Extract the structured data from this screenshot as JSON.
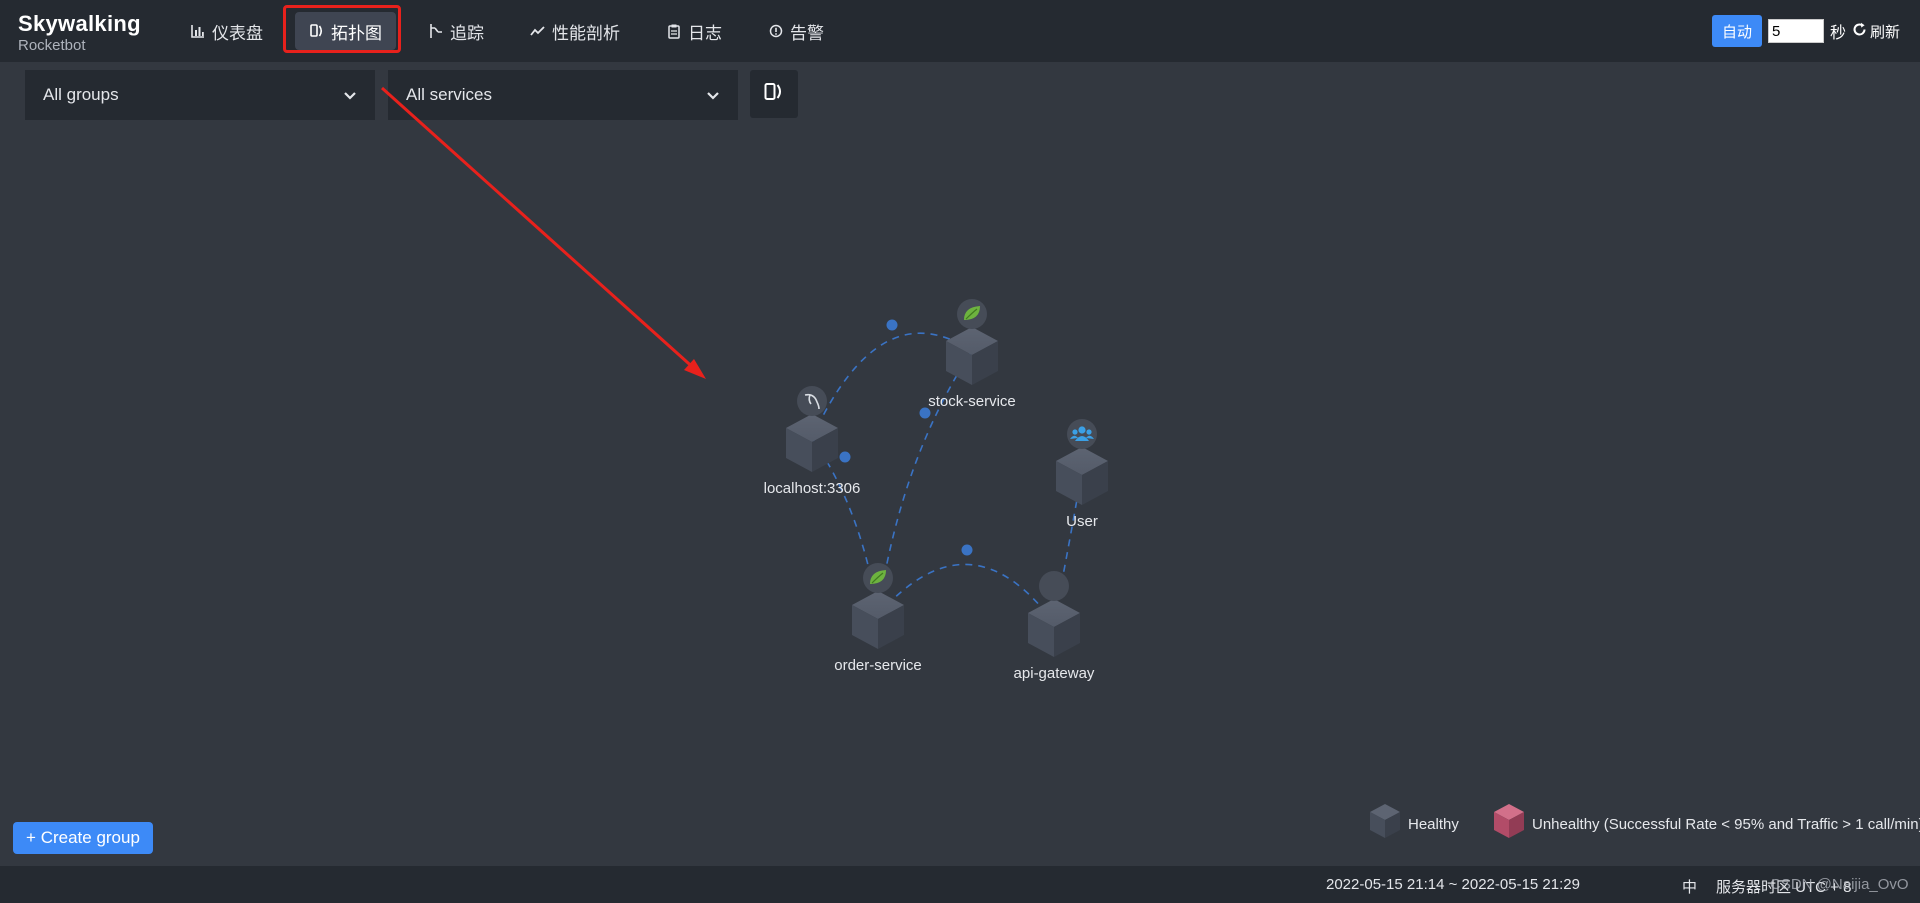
{
  "brand": {
    "name": "Skywalking",
    "subtitle": "Rocketbot"
  },
  "nav": [
    {
      "label": "仪表盘",
      "icon": "bar-chart-icon"
    },
    {
      "label": "拓扑图",
      "icon": "topology-icon",
      "active": true
    },
    {
      "label": "追踪",
      "icon": "trace-icon"
    },
    {
      "label": "性能剖析",
      "icon": "line-chart-icon"
    },
    {
      "label": "日志",
      "icon": "clipboard-icon"
    },
    {
      "label": "告警",
      "icon": "alarm-icon"
    }
  ],
  "controls": {
    "auto_label": "自动",
    "interval_value": "5",
    "sec_label": "秒",
    "refresh_label": "刷新"
  },
  "filters": {
    "group": "All groups",
    "service": "All services"
  },
  "topology": {
    "nodes": [
      {
        "id": "stock",
        "label": "stock-service",
        "icon": "spring-leaf-icon"
      },
      {
        "id": "db",
        "label": "localhost:3306",
        "icon": "mysql-dolphin-icon"
      },
      {
        "id": "user",
        "label": "User",
        "icon": "users-icon"
      },
      {
        "id": "order",
        "label": "order-service",
        "icon": "spring-leaf-icon"
      },
      {
        "id": "gateway",
        "label": "api-gateway",
        "icon": "gateway-icon"
      }
    ],
    "links": [
      {
        "from": "db",
        "to": "stock"
      },
      {
        "from": "order",
        "to": "db"
      },
      {
        "from": "order",
        "to": "stock"
      },
      {
        "from": "order",
        "to": "gateway"
      },
      {
        "from": "gateway",
        "to": "user"
      }
    ]
  },
  "create_group_label": "+ Create group",
  "legend": {
    "healthy": "Healthy",
    "unhealthy": "Unhealthy (Successful Rate < 95% and Traffic > 1 call/min)"
  },
  "footer": {
    "time_range": "2022-05-15 21:14 ~ 2022-05-15 21:29",
    "lang": "中",
    "timezone": "服务器时区 UTC + 8",
    "watermark": "CSDN @Naijia_OvO"
  },
  "colors": {
    "accent": "#3d8af7",
    "highlight": "#e8211c",
    "healthy": "#4b5260",
    "unhealthy": "#c0526f",
    "link": "#3a73c4"
  }
}
